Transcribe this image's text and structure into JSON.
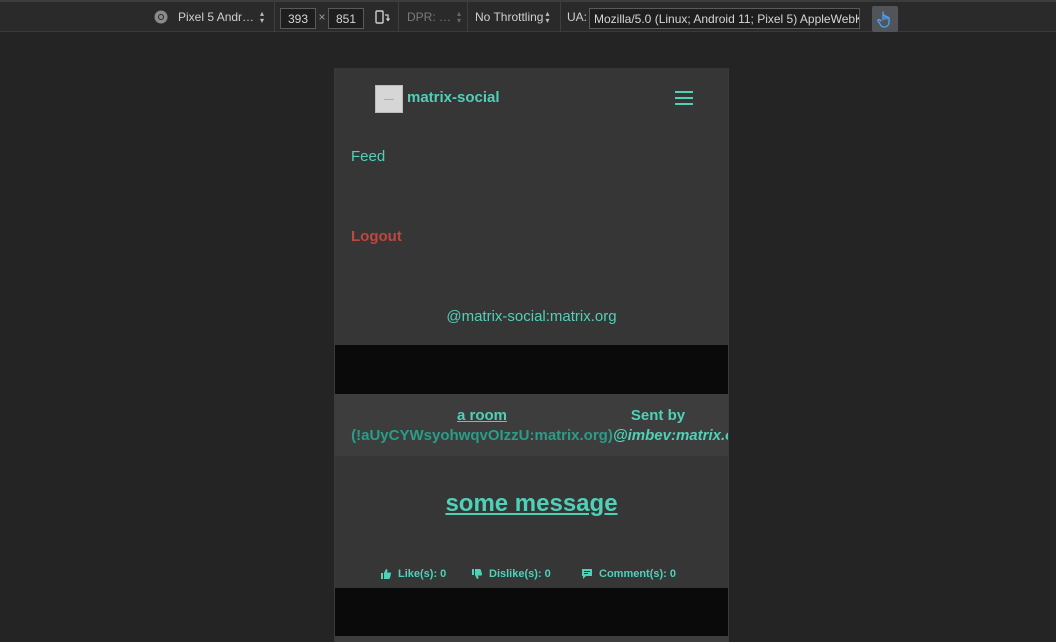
{
  "devtools": {
    "device": "Pixel 5 Andr…",
    "width": "393",
    "times": "×",
    "height": "851",
    "dpr": "DPR: …",
    "throttling": "No Throttling",
    "ua_label": "UA:",
    "ua_value": "Mozilla/5.0 (Linux; Android 11; Pixel 5) AppleWebK"
  },
  "app": {
    "brand": "matrix-social",
    "logo_alt": "—",
    "nav": {
      "feed": "Feed",
      "logout": "Logout",
      "user_id": "@matrix-social:matrix.org"
    }
  },
  "post": {
    "room_label": "a room",
    "room_id": "(!aUyCYWsyohwqvOIzzU:matrix.org)",
    "sent_by_label": "Sent by",
    "sender": "@imbev:matrix.o",
    "message": "some message",
    "likes": "Like(s): 0",
    "dislikes": "Dislike(s): 0",
    "comments": "Comment(s): 0"
  },
  "colors": {
    "accent": "#4fd1b8",
    "danger": "#c0463e",
    "panel": "#363636"
  }
}
